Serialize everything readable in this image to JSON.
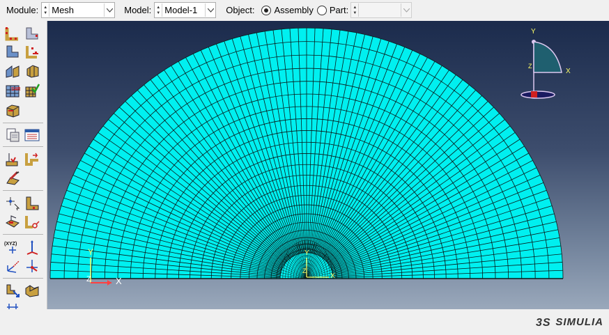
{
  "context_bar": {
    "module_label": "Module:",
    "module_value": "Mesh",
    "model_label": "Model:",
    "model_value": "Model-1",
    "object_label": "Object:",
    "assembly_label": "Assembly",
    "part_label": "Part:",
    "part_value": "",
    "selected_object": "Assembly"
  },
  "toolbox": {
    "tools": [
      "seed-part-icon",
      "seed-edges-icon",
      "delete-part-seeds-icon",
      "delete-edge-seeds-icon",
      "mesh-controls-icon",
      "element-type-icon",
      "mesh-part-icon",
      "verify-mesh-icon",
      "partition-cell-icon",
      "query-icon",
      "mesh-stats-icon",
      "create-set-icon",
      "set-manager-icon",
      "edit-mesh-icon",
      "datum-point-icon",
      "datum-axis-icon",
      "partition-face-icon",
      "partition-edge-icon",
      "datum-csys-icon",
      "datum-plane-icon",
      "axis-triad-icon",
      "translate-icon",
      "instance-icon",
      "assembly-icon",
      "more-tools-icon"
    ],
    "xyz_label": "(XYZ)"
  },
  "viewport": {
    "mesh_color": "#00f0f0",
    "edge_color": "#0a1a1a",
    "triad": {
      "x": "X",
      "y": "Y",
      "z": "Z"
    },
    "local_triad": {
      "x": "X",
      "y": "Y",
      "z": "Z"
    },
    "view_triad": {
      "x": "X",
      "y": "Y",
      "z": "Z"
    }
  },
  "status": {
    "brand": "SIMULIA"
  }
}
